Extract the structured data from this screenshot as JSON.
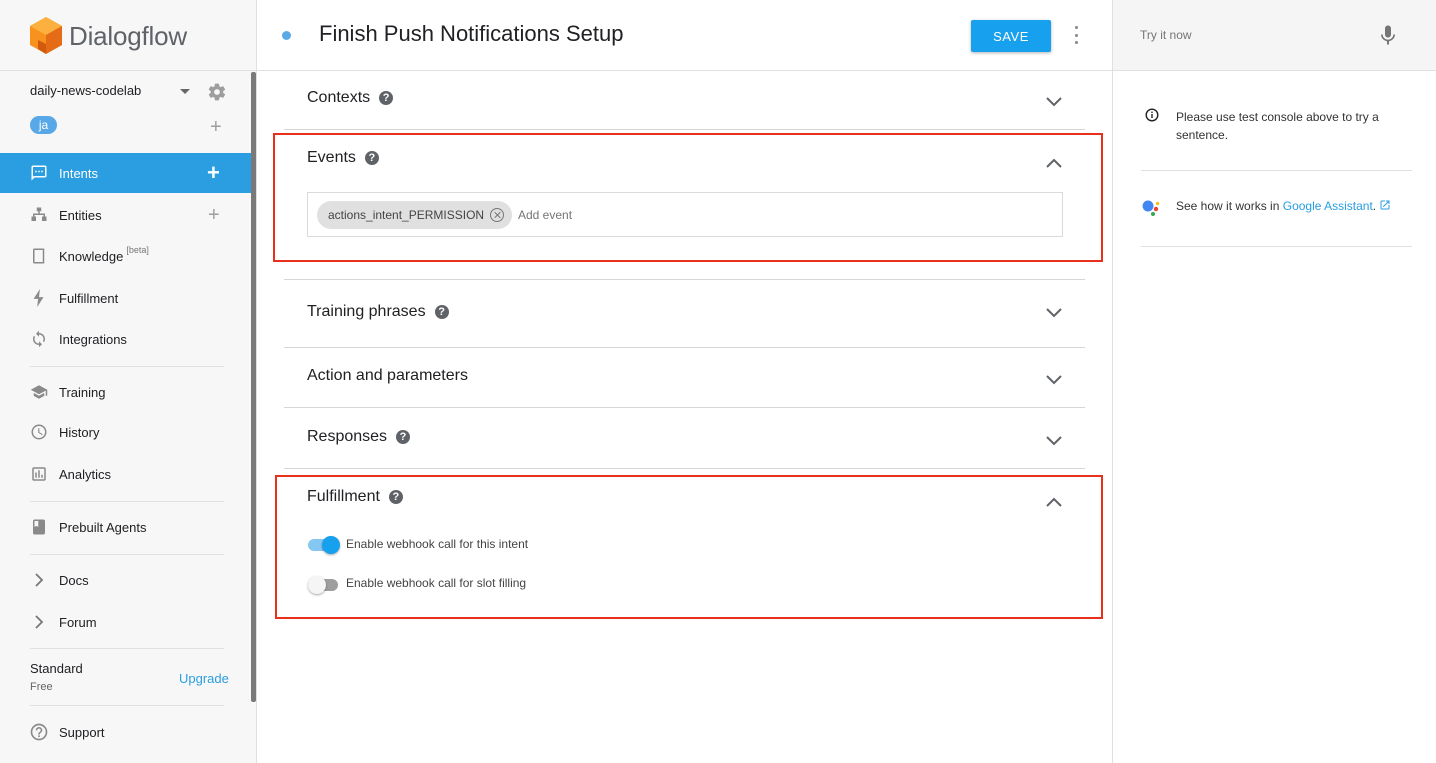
{
  "app": {
    "name": "Dialogflow"
  },
  "sidebar": {
    "agent_name": "daily-news-codelab",
    "language": "ja",
    "nav": {
      "intents": "Intents",
      "entities": "Entities",
      "knowledge": "Knowledge",
      "knowledge_badge": "[beta]",
      "fulfillment": "Fulfillment",
      "integrations": "Integrations",
      "training": "Training",
      "history": "History",
      "analytics": "Analytics",
      "prebuilt_agents": "Prebuilt Agents",
      "docs": "Docs",
      "forum": "Forum",
      "support": "Support"
    },
    "plan": {
      "name": "Standard",
      "tier": "Free",
      "upgrade": "Upgrade"
    }
  },
  "header": {
    "title": "Finish Push Notifications Setup",
    "save_label": "SAVE"
  },
  "sections": {
    "contexts": "Contexts",
    "events": "Events",
    "event_chip": "actions_intent_PERMISSION",
    "add_event_placeholder": "Add event",
    "training_phrases": "Training phrases",
    "action_parameters": "Action and parameters",
    "responses": "Responses",
    "fulfillment": "Fulfillment",
    "webhook_intent_label": "Enable webhook call for this intent",
    "webhook_slot_label": "Enable webhook call for slot filling",
    "webhook_intent_enabled": true,
    "webhook_slot_enabled": false
  },
  "right_panel": {
    "try_placeholder": "Try it now",
    "info_text": "Please use test console above to try a sentence.",
    "ga_prefix": "See how it works in",
    "ga_link": "Google Assistant",
    "ga_suffix": "."
  },
  "colors": {
    "accent": "#2a9ee0",
    "save_button": "#16a0ee",
    "highlight_box": "#e8311d",
    "logo_orange": "#f28c1e"
  }
}
